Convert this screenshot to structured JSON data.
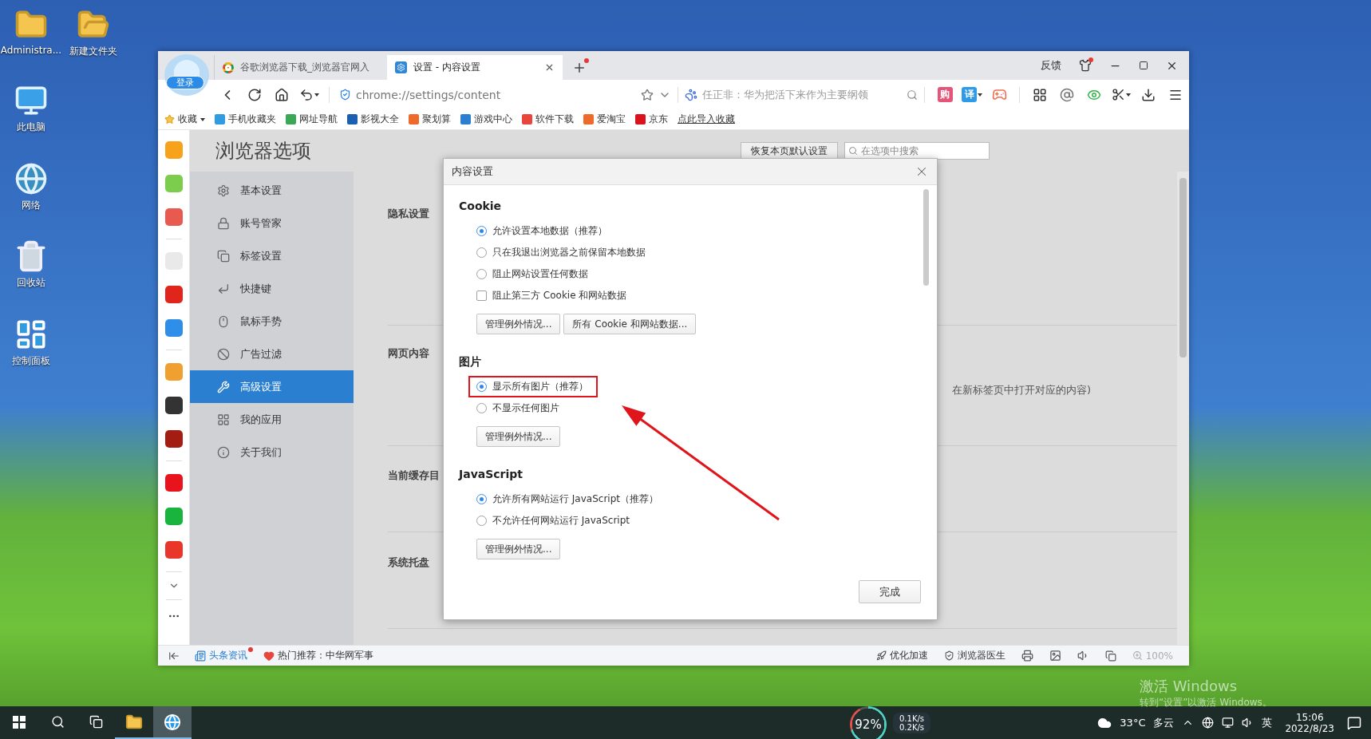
{
  "desktop_icons": [
    {
      "label": "Administra...",
      "kind": "user-folder"
    },
    {
      "label": "新建文件夹",
      "kind": "folder"
    },
    {
      "label": "此电脑",
      "kind": "computer"
    },
    {
      "label": "网络",
      "kind": "network"
    },
    {
      "label": "回收站",
      "kind": "recycle-bin"
    },
    {
      "label": "控制面板",
      "kind": "control-panel"
    }
  ],
  "browser": {
    "login_button": "登录",
    "tabs": [
      {
        "title": "谷歌浏览器下载_浏览器官网入",
        "selected": false
      },
      {
        "title": "设置 - 内容设置",
        "selected": true
      }
    ],
    "feedback": "反馈",
    "address": "chrome://settings/content",
    "news_suggestion": "任正非：华为把活下来作为主要纲领",
    "toolbar_badges": [
      "购",
      "译"
    ],
    "bookmarks": [
      {
        "label": "收藏"
      },
      {
        "label": "手机收藏夹"
      },
      {
        "label": "网址导航"
      },
      {
        "label": "影视大全"
      },
      {
        "label": "聚划算"
      },
      {
        "label": "游戏中心"
      },
      {
        "label": "软件下载"
      },
      {
        "label": "爱淘宝"
      },
      {
        "label": "京东"
      }
    ],
    "import_link": "点此导入收藏"
  },
  "settings": {
    "title": "浏览器选项",
    "reset_button": "恢复本页默认设置",
    "search_placeholder": "在选项中搜索",
    "nav": [
      {
        "label": "基本设置",
        "selected": false
      },
      {
        "label": "账号管家",
        "selected": false
      },
      {
        "label": "标签设置",
        "selected": false
      },
      {
        "label": "快捷键",
        "selected": false
      },
      {
        "label": "鼠标手势",
        "selected": false
      },
      {
        "label": "广告过滤",
        "selected": false
      },
      {
        "label": "高级设置",
        "selected": true
      },
      {
        "label": "我的应用",
        "selected": false
      },
      {
        "label": "关于我们",
        "selected": false
      }
    ],
    "sections": [
      {
        "heading": "隐私设置"
      },
      {
        "heading": "网页内容",
        "note": "在新标签页中打开对应的内容)"
      },
      {
        "heading": "当前缓存目"
      },
      {
        "heading": "系统托盘"
      }
    ]
  },
  "dialog": {
    "title": "内容设置",
    "groups": [
      {
        "heading": "Cookie",
        "options": [
          {
            "label": "允许设置本地数据（推荐）",
            "selected": true,
            "highlighted": false
          },
          {
            "label": "只在我退出浏览器之前保留本地数据",
            "selected": false,
            "highlighted": false
          },
          {
            "label": "阻止网站设置任何数据",
            "selected": false,
            "highlighted": false
          }
        ],
        "checkbox": {
          "label": "阻止第三方 Cookie 和网站数据",
          "checked": false
        },
        "buttons": [
          "管理例外情况...",
          "所有 Cookie 和网站数据..."
        ]
      },
      {
        "heading": "图片",
        "options": [
          {
            "label": "显示所有图片（推荐）",
            "selected": true,
            "highlighted": true
          },
          {
            "label": "不显示任何图片",
            "selected": false,
            "highlighted": false
          }
        ],
        "buttons": [
          "管理例外情况..."
        ]
      },
      {
        "heading": "JavaScript",
        "options": [
          {
            "label": "允许所有网站运行 JavaScript（推荐）",
            "selected": true,
            "highlighted": false
          },
          {
            "label": "不允许任何网站运行 JavaScript",
            "selected": false,
            "highlighted": false
          }
        ],
        "buttons": [
          "管理例外情况..."
        ]
      }
    ],
    "done_button": "完成"
  },
  "status_bar": {
    "news": {
      "label": "头条资讯",
      "unread": true
    },
    "hot": "热门推荐：中华网军事",
    "speedup": "优化加速",
    "doctor": "浏览器医生",
    "zoom": "100%"
  },
  "activation": {
    "title": "激活 Windows",
    "hint": "转到“设置”以激活 Windows。"
  },
  "taskbar": {
    "apps": [
      {
        "kind": "folder",
        "active": false
      },
      {
        "kind": "browser",
        "active": true
      }
    ],
    "cpu": "92%",
    "upload": "0.1K/s",
    "download": "0.2K/s",
    "temperature": "33°C",
    "weather": "多云",
    "ime": "英",
    "time": "15:06",
    "date": "2022/8/23"
  }
}
